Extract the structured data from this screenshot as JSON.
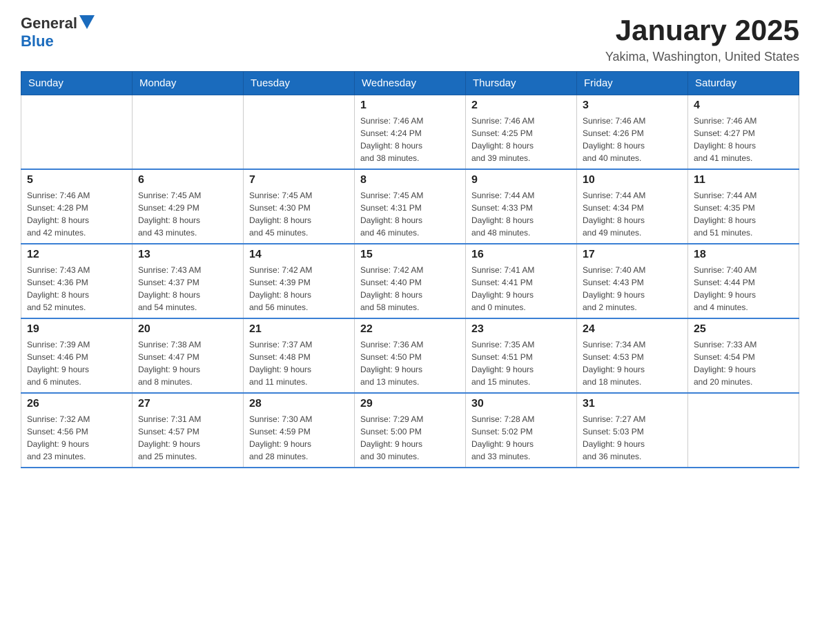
{
  "logo": {
    "text_general": "General",
    "text_blue": "Blue"
  },
  "title": "January 2025",
  "subtitle": "Yakima, Washington, United States",
  "days_of_week": [
    "Sunday",
    "Monday",
    "Tuesday",
    "Wednesday",
    "Thursday",
    "Friday",
    "Saturday"
  ],
  "weeks": [
    [
      {
        "day": "",
        "info": ""
      },
      {
        "day": "",
        "info": ""
      },
      {
        "day": "",
        "info": ""
      },
      {
        "day": "1",
        "info": "Sunrise: 7:46 AM\nSunset: 4:24 PM\nDaylight: 8 hours\nand 38 minutes."
      },
      {
        "day": "2",
        "info": "Sunrise: 7:46 AM\nSunset: 4:25 PM\nDaylight: 8 hours\nand 39 minutes."
      },
      {
        "day": "3",
        "info": "Sunrise: 7:46 AM\nSunset: 4:26 PM\nDaylight: 8 hours\nand 40 minutes."
      },
      {
        "day": "4",
        "info": "Sunrise: 7:46 AM\nSunset: 4:27 PM\nDaylight: 8 hours\nand 41 minutes."
      }
    ],
    [
      {
        "day": "5",
        "info": "Sunrise: 7:46 AM\nSunset: 4:28 PM\nDaylight: 8 hours\nand 42 minutes."
      },
      {
        "day": "6",
        "info": "Sunrise: 7:45 AM\nSunset: 4:29 PM\nDaylight: 8 hours\nand 43 minutes."
      },
      {
        "day": "7",
        "info": "Sunrise: 7:45 AM\nSunset: 4:30 PM\nDaylight: 8 hours\nand 45 minutes."
      },
      {
        "day": "8",
        "info": "Sunrise: 7:45 AM\nSunset: 4:31 PM\nDaylight: 8 hours\nand 46 minutes."
      },
      {
        "day": "9",
        "info": "Sunrise: 7:44 AM\nSunset: 4:33 PM\nDaylight: 8 hours\nand 48 minutes."
      },
      {
        "day": "10",
        "info": "Sunrise: 7:44 AM\nSunset: 4:34 PM\nDaylight: 8 hours\nand 49 minutes."
      },
      {
        "day": "11",
        "info": "Sunrise: 7:44 AM\nSunset: 4:35 PM\nDaylight: 8 hours\nand 51 minutes."
      }
    ],
    [
      {
        "day": "12",
        "info": "Sunrise: 7:43 AM\nSunset: 4:36 PM\nDaylight: 8 hours\nand 52 minutes."
      },
      {
        "day": "13",
        "info": "Sunrise: 7:43 AM\nSunset: 4:37 PM\nDaylight: 8 hours\nand 54 minutes."
      },
      {
        "day": "14",
        "info": "Sunrise: 7:42 AM\nSunset: 4:39 PM\nDaylight: 8 hours\nand 56 minutes."
      },
      {
        "day": "15",
        "info": "Sunrise: 7:42 AM\nSunset: 4:40 PM\nDaylight: 8 hours\nand 58 minutes."
      },
      {
        "day": "16",
        "info": "Sunrise: 7:41 AM\nSunset: 4:41 PM\nDaylight: 9 hours\nand 0 minutes."
      },
      {
        "day": "17",
        "info": "Sunrise: 7:40 AM\nSunset: 4:43 PM\nDaylight: 9 hours\nand 2 minutes."
      },
      {
        "day": "18",
        "info": "Sunrise: 7:40 AM\nSunset: 4:44 PM\nDaylight: 9 hours\nand 4 minutes."
      }
    ],
    [
      {
        "day": "19",
        "info": "Sunrise: 7:39 AM\nSunset: 4:46 PM\nDaylight: 9 hours\nand 6 minutes."
      },
      {
        "day": "20",
        "info": "Sunrise: 7:38 AM\nSunset: 4:47 PM\nDaylight: 9 hours\nand 8 minutes."
      },
      {
        "day": "21",
        "info": "Sunrise: 7:37 AM\nSunset: 4:48 PM\nDaylight: 9 hours\nand 11 minutes."
      },
      {
        "day": "22",
        "info": "Sunrise: 7:36 AM\nSunset: 4:50 PM\nDaylight: 9 hours\nand 13 minutes."
      },
      {
        "day": "23",
        "info": "Sunrise: 7:35 AM\nSunset: 4:51 PM\nDaylight: 9 hours\nand 15 minutes."
      },
      {
        "day": "24",
        "info": "Sunrise: 7:34 AM\nSunset: 4:53 PM\nDaylight: 9 hours\nand 18 minutes."
      },
      {
        "day": "25",
        "info": "Sunrise: 7:33 AM\nSunset: 4:54 PM\nDaylight: 9 hours\nand 20 minutes."
      }
    ],
    [
      {
        "day": "26",
        "info": "Sunrise: 7:32 AM\nSunset: 4:56 PM\nDaylight: 9 hours\nand 23 minutes."
      },
      {
        "day": "27",
        "info": "Sunrise: 7:31 AM\nSunset: 4:57 PM\nDaylight: 9 hours\nand 25 minutes."
      },
      {
        "day": "28",
        "info": "Sunrise: 7:30 AM\nSunset: 4:59 PM\nDaylight: 9 hours\nand 28 minutes."
      },
      {
        "day": "29",
        "info": "Sunrise: 7:29 AM\nSunset: 5:00 PM\nDaylight: 9 hours\nand 30 minutes."
      },
      {
        "day": "30",
        "info": "Sunrise: 7:28 AM\nSunset: 5:02 PM\nDaylight: 9 hours\nand 33 minutes."
      },
      {
        "day": "31",
        "info": "Sunrise: 7:27 AM\nSunset: 5:03 PM\nDaylight: 9 hours\nand 36 minutes."
      },
      {
        "day": "",
        "info": ""
      }
    ]
  ]
}
